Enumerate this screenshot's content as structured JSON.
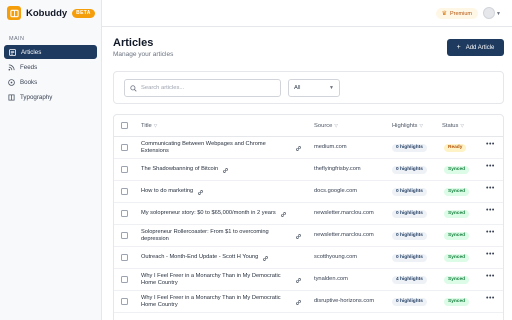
{
  "app": {
    "name": "Kobuddy",
    "badge": "BETA"
  },
  "sidebar": {
    "section": "MAIN",
    "items": [
      {
        "label": "Articles",
        "icon": "articles-icon",
        "active": true
      },
      {
        "label": "Feeds",
        "icon": "rss-icon",
        "active": false
      },
      {
        "label": "Books",
        "icon": "book-icon",
        "active": false
      },
      {
        "label": "Typography",
        "icon": "typography-icon",
        "active": false
      }
    ]
  },
  "topbar": {
    "premium_label": "Premium"
  },
  "page": {
    "title": "Articles",
    "subtitle": "Manage your articles",
    "add_button": "Add Article"
  },
  "filters": {
    "search_placeholder": "Search articles...",
    "select_value": "All"
  },
  "table": {
    "columns": {
      "title": "Title",
      "source": "Source",
      "highlights": "Highlights",
      "status": "Status"
    },
    "rows": [
      {
        "title": "Communicating Between Webpages and Chrome Extensions",
        "source": "medium.com",
        "highlights": "0 highlights",
        "status": "Ready"
      },
      {
        "title": "The Shadowbanning of Bitcoin",
        "source": "theflyingfrisby.com",
        "highlights": "0 highlights",
        "status": "Synced"
      },
      {
        "title": "How to do marketing",
        "source": "docs.google.com",
        "highlights": "0 highlights",
        "status": "Synced"
      },
      {
        "title": "My solopreneur story: $0 to $65,000/month in 2 years",
        "source": "newsletter.marclou.com",
        "highlights": "0 highlights",
        "status": "Synced"
      },
      {
        "title": "Solopreneur Rollercoaster: From $1 to overcoming depression",
        "source": "newsletter.marclou.com",
        "highlights": "0 highlights",
        "status": "Synced"
      },
      {
        "title": "Outreach - Month-End Update - Scott H Young",
        "source": "scotthyoung.com",
        "highlights": "0 highlights",
        "status": "Synced"
      },
      {
        "title": "Why I Feel Freer in a Monarchy Than in My Democratic Home Country",
        "source": "tynalden.com",
        "highlights": "4 highlights",
        "status": "Synced"
      },
      {
        "title": "Why I Feel Freer in a Monarchy Than in My Democratic Home Country",
        "source": "disruptive-horizons.com",
        "highlights": "0 highlights",
        "status": "Synced"
      }
    ]
  },
  "colors": {
    "accent": "#1e3a5f",
    "brand": "#f59e0b",
    "synced": "#15803d",
    "ready": "#b45309"
  }
}
